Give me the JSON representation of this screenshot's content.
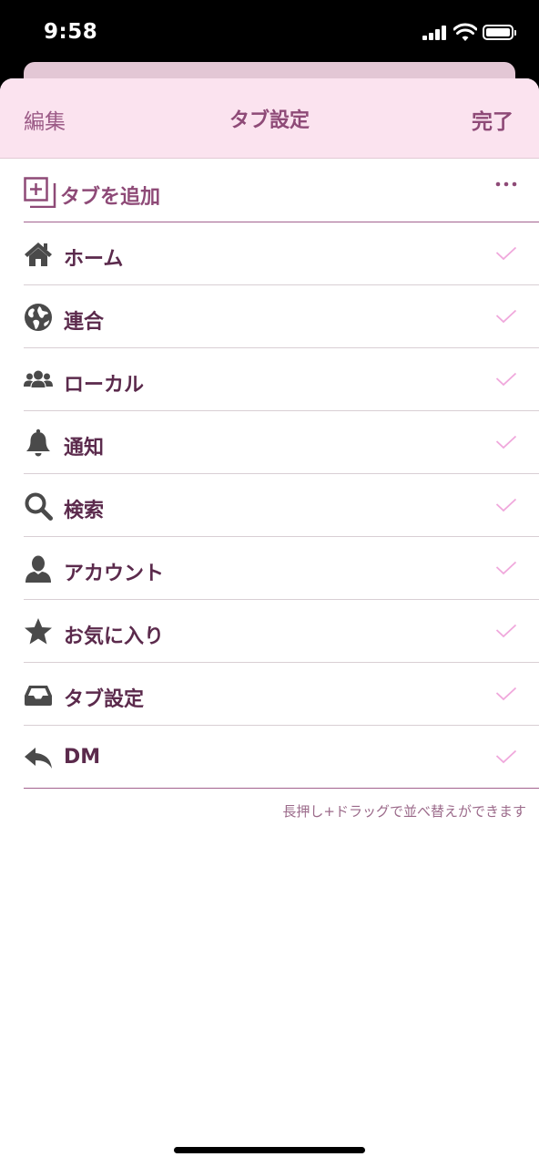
{
  "status_bar": {
    "time": "9:58"
  },
  "nav": {
    "edit_label": "編集",
    "title": "タブ設定",
    "done_label": "完了"
  },
  "add_tab": {
    "label": "タブを追加",
    "more_icon": "ellipsis-icon",
    "icon": "add-tab-icon"
  },
  "tabs": [
    {
      "label": "ホーム",
      "icon": "home-icon",
      "checked": true
    },
    {
      "label": "連合",
      "icon": "globe-icon",
      "checked": true
    },
    {
      "label": "ローカル",
      "icon": "users-icon",
      "checked": true
    },
    {
      "label": "通知",
      "icon": "bell-icon",
      "checked": true
    },
    {
      "label": "検索",
      "icon": "search-icon",
      "checked": true
    },
    {
      "label": "アカウント",
      "icon": "user-icon",
      "checked": true
    },
    {
      "label": "お気に入り",
      "icon": "star-icon",
      "checked": true
    },
    {
      "label": "タブ設定",
      "icon": "inbox-icon",
      "checked": true
    },
    {
      "label": "DM",
      "icon": "reply-icon",
      "checked": true
    }
  ],
  "footer": {
    "note": "長押し+ドラッグで並べ替えができます"
  },
  "colors": {
    "accent": "#8e4a77",
    "nav_background": "#fbe3ef",
    "label": "#5b2a4c",
    "icon": "#4a4a4a",
    "check": "#f0a8dc"
  }
}
